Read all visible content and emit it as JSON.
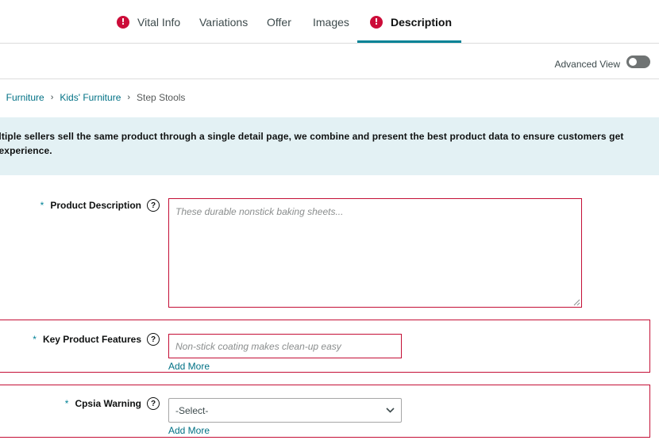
{
  "tabs": [
    {
      "label": "Vital Info",
      "error": true
    },
    {
      "label": "Variations",
      "error": false
    },
    {
      "label": "Offer",
      "error": false
    },
    {
      "label": "Images",
      "error": false
    },
    {
      "label": "Description",
      "error": true,
      "active": true
    }
  ],
  "error_glyph": "!",
  "advanced_view": {
    "label": "Advanced View",
    "enabled": false
  },
  "breadcrumb": {
    "items": [
      "Furniture",
      "Kids' Furniture"
    ],
    "current": "Step Stools",
    "separator": "›"
  },
  "banner": {
    "line1": "ultiple sellers sell the same product through a single detail page, we combine and present the best product data to ensure customers get",
    "line2": "t experience."
  },
  "fields": {
    "product_description": {
      "label": "Product Description",
      "placeholder": "These durable nonstick baking sheets..."
    },
    "key_product_features": {
      "label": "Key Product Features",
      "placeholder": "Non-stick coating makes clean-up easy",
      "add_more": "Add More"
    },
    "cpsia_warning": {
      "label": "Cpsia Warning",
      "selected": "-Select-",
      "add_more": "Add More"
    }
  },
  "required_marker": "*",
  "help_glyph": "?",
  "colors": {
    "accent": "#008296",
    "link": "#007185",
    "error": "#c40f36",
    "banner_bg": "#e3f1f4"
  }
}
